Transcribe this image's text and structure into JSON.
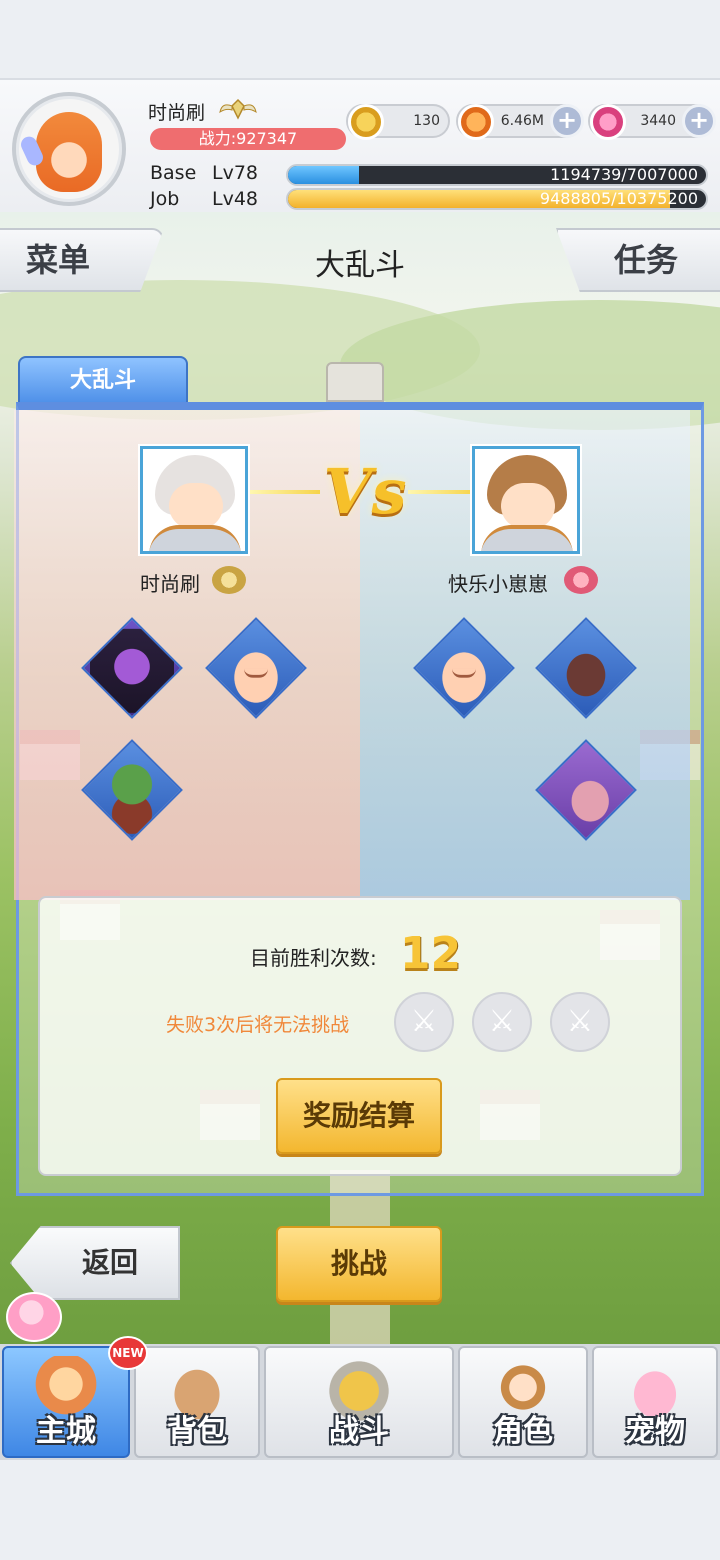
{
  "player": {
    "name": "时尚刷",
    "power": "战力:927347",
    "currencies": {
      "zeny": "130",
      "gold": "6.46M",
      "gems": "3440"
    },
    "base_label": "Base",
    "base_level": "Lv78",
    "base_exp": "1194739/7007000",
    "base_exp_fraction": 0.17,
    "job_label": "Job",
    "job_level": "Lv48",
    "job_exp": "9488805/10375200",
    "job_exp_fraction": 0.915
  },
  "header": {
    "menu_label": "菜单",
    "title": "大乱斗",
    "task_label": "任务"
  },
  "panel": {
    "tab_label": "大乱斗",
    "vs_text": "Vs",
    "left_name": "时尚刷",
    "right_name": "快乐小崽崽",
    "left_pets": [
      "purple-demon-icon",
      "poring-icon",
      "orc-warrior-icon"
    ],
    "right_pets": [
      "poring-icon",
      "boar-icon",
      "worm-tail-icon"
    ]
  },
  "result": {
    "wins_label": "目前胜利次数:",
    "wins_count": "12",
    "warning": "失败3次后将无法挑战",
    "lives_icon": "crossed-swords-icon",
    "reward_button": "奖励结算"
  },
  "actions": {
    "back_label": "返回",
    "fight_label": "挑战"
  },
  "nav": {
    "new_badge": "NEW",
    "items": [
      {
        "label": "主城",
        "icon": "castle-icon",
        "active": true
      },
      {
        "label": "背包",
        "icon": "backpack-icon",
        "active": false
      },
      {
        "label": "战斗",
        "icon": "battle-emblem-icon",
        "active": false
      },
      {
        "label": "角色",
        "icon": "character-icon",
        "active": false
      },
      {
        "label": "宠物",
        "icon": "pet-icon",
        "active": false
      }
    ]
  },
  "colors": {
    "accent_blue": "#4d8fe8",
    "power_red": "#ef6d6f",
    "gold_button": "#f3b72f",
    "warning_orange": "#f0883a"
  }
}
